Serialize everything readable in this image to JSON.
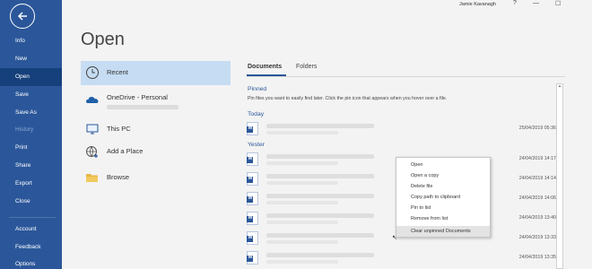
{
  "window": {
    "user": "Jamie Kavanagh",
    "help": "?",
    "minimize": "—",
    "restore": "☐"
  },
  "nav": {
    "items": [
      "Info",
      "New",
      "Open",
      "Save",
      "Save As",
      "History",
      "Print",
      "Share",
      "Export",
      "Close",
      "Account",
      "Feedback",
      "Options"
    ]
  },
  "page_title": "Open",
  "locations": [
    "Recent",
    "OneDrive - Personal",
    "This PC",
    "Add a Place",
    "Browse"
  ],
  "tabs": [
    "Documents",
    "Folders"
  ],
  "sections": {
    "pinned": "Pinned",
    "pinned_hint": "Pin files you want to easily find later. Click the pin icon that appears when you hover over a file.",
    "today": "Today",
    "yesterday": "Yester"
  },
  "documents": {
    "dates": [
      "25/04/2019 05:36",
      "24/04/2019 14:17",
      "24/04/2019 14:14",
      "24/04/2019 14:06",
      "24/04/2019 13:40",
      "24/04/2019 13:33",
      "24/04/2019 13:35"
    ]
  },
  "context_menu": [
    "Open",
    "Open a copy",
    "Delete file",
    "Copy path to clipboard",
    "Pin to list",
    "Remove from list",
    "Clear unpinned Documents"
  ]
}
